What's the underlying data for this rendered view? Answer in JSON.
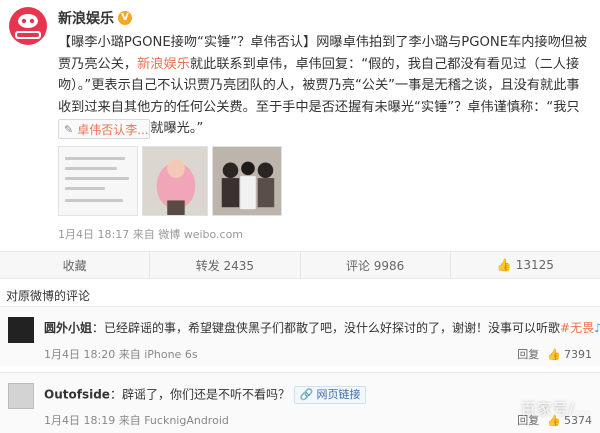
{
  "post": {
    "author": "新浪娱乐",
    "verified_badge": "V",
    "content_start": "【曝李小璐PGONE接吻“实锤”？卓伟否认】网曝卓伟拍到了李小璐与PGONE车内接吻但被贾乃亮公关，",
    "content_mention": "新浪娱乐",
    "content_end": "就此联系到卓伟，卓伟回复：“假的，我自己都没有看见过（二人接吻）。”更表示自己不认识贾乃亮团队的人，被贾乃亮“公关”一事是无稽之谈，且没有就此事收到过来自其他方的任何公关费。至于手中是否还握有未曝光“实锤”？卓伟谨慎称：“我只能说，拍到了，就曝光。”",
    "link_card": "卓伟否认李...",
    "link_icon": "edit-icon",
    "time": "1月4日 18:17",
    "source": "来自 微博 weibo.com"
  },
  "actions": {
    "collect": "收藏",
    "repost": "转发 2435",
    "comment": "评论 9986",
    "like": "13125"
  },
  "comments_title": "对原微博的评论",
  "comments": [
    {
      "user": "圆外小姐",
      "text": "：已经辟谣的事，希望键盘侠黑子们都散了吧，没什么好探讨的了，谢谢！没事可以听歌",
      "tag": "#无畏",
      "tag_end": "#",
      "time": "1月4日 18:20",
      "source": "来自 iPhone 6s",
      "reply": "回复",
      "likes": "7391"
    },
    {
      "user": "Outofside",
      "text": "：辟谣了，你们还是不听不看吗？",
      "card": "网页链接",
      "time": "1月4日 18:19",
      "source": "来自 FucknigAndroid",
      "reply": "回复",
      "likes": "5374"
    }
  ],
  "watermark": "百家号/..."
}
